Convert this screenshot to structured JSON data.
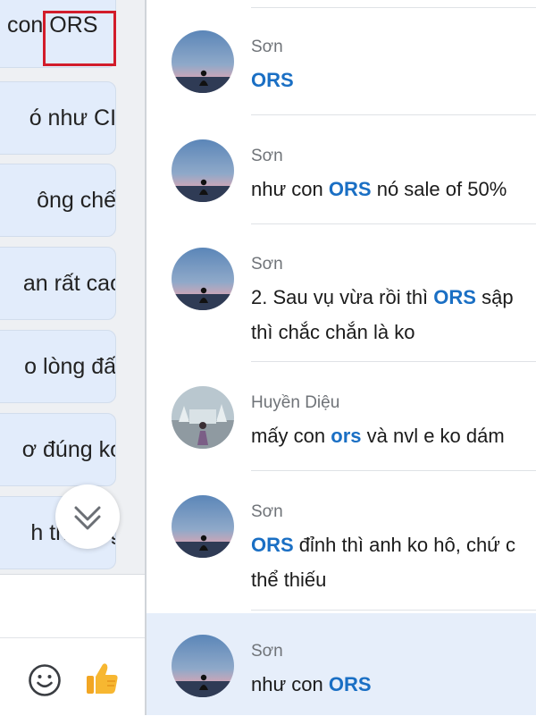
{
  "left_pane": {
    "bubbles": [
      {
        "text": "con ORS"
      },
      {
        "text": "ó như CII"
      },
      {
        "text": "ông chết"
      },
      {
        "text": "an rất cao"
      },
      {
        "text": "o lòng đất"
      },
      {
        "text": "ơ đúng ko"
      },
      {
        "text": "h thương"
      }
    ]
  },
  "messages": [
    {
      "sender": "Sơn",
      "lines": [
        [
          {
            "t": "ORS",
            "hl": true
          }
        ]
      ]
    },
    {
      "sender": "Sơn",
      "lines": [
        [
          {
            "t": "như con "
          },
          {
            "t": "ORS",
            "hl": true
          },
          {
            "t": " nó sale of 50%"
          }
        ]
      ]
    },
    {
      "sender": "Sơn",
      "lines": [
        [
          {
            "t": "2. Sau vụ vừa rồi thì "
          },
          {
            "t": "ORS",
            "hl": true
          },
          {
            "t": " sập"
          }
        ],
        [
          {
            "t": "thì chắc chắn là ko"
          }
        ]
      ]
    },
    {
      "sender": "Huyền Diệu",
      "lines": [
        [
          {
            "t": "mấy con "
          },
          {
            "t": "ors",
            "hl": true
          },
          {
            "t": " và nvl e ko dám"
          }
        ]
      ]
    },
    {
      "sender": "Sơn",
      "lines": [
        [
          {
            "t": "ORS",
            "hl": true
          },
          {
            "t": " đỉnh thì anh ko hô, chứ c"
          }
        ],
        [
          {
            "t": "thể thiếu"
          }
        ]
      ]
    },
    {
      "sender": "Sơn",
      "lines": [
        [
          {
            "t": "như con "
          },
          {
            "t": "ORS",
            "hl": true
          }
        ]
      ]
    }
  ],
  "icons": {
    "scroll_down": "double-chevron-down-icon",
    "emoji": "smiley-icon",
    "like": "thumbs-up-icon"
  },
  "colors": {
    "highlight_text": "#1a6fc4",
    "search_highlight_box": "#d21c2a",
    "active_row_bg": "#e6eefa",
    "bubble_bg": "#e2ecfb"
  }
}
